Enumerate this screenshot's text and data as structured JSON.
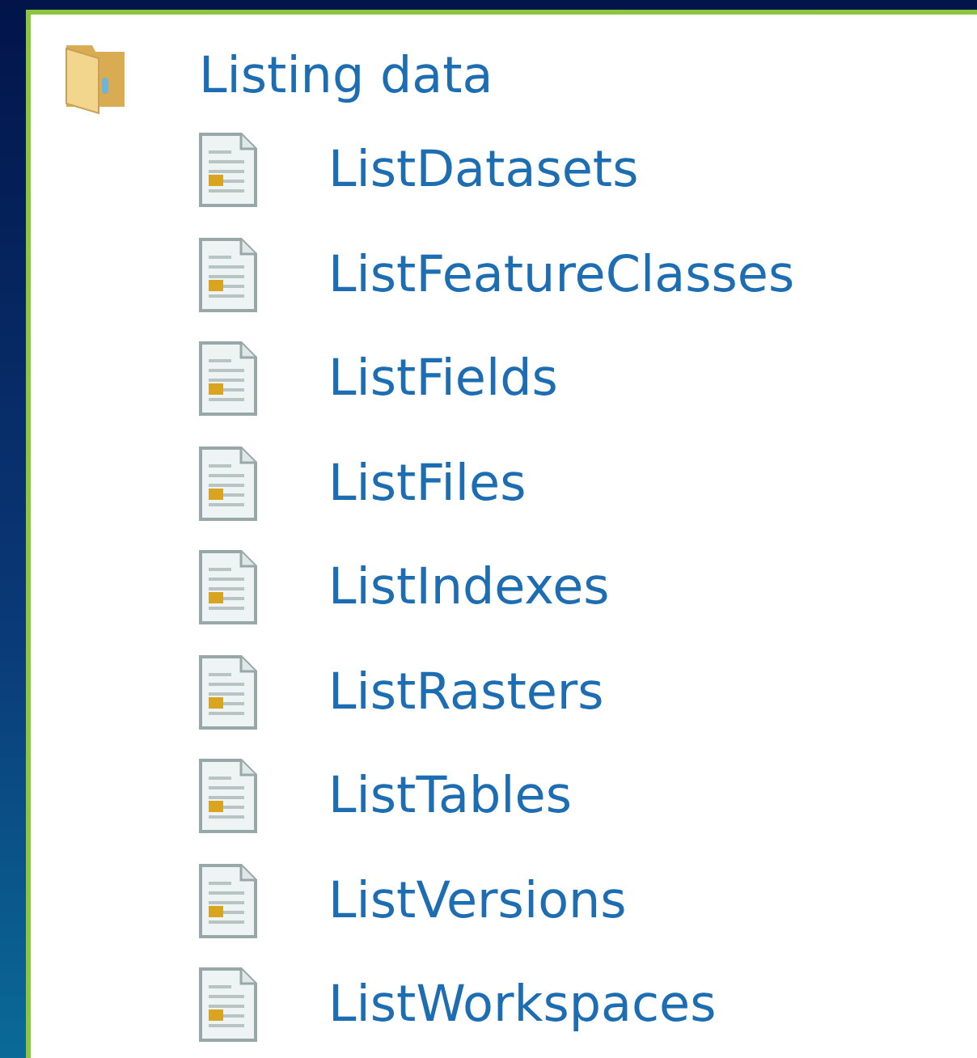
{
  "tree": {
    "label": "Listing data",
    "kind": "folder",
    "children": [
      {
        "label": "ListDatasets",
        "kind": "file"
      },
      {
        "label": "ListFeatureClasses",
        "kind": "file"
      },
      {
        "label": "ListFields",
        "kind": "file"
      },
      {
        "label": "ListFiles",
        "kind": "file"
      },
      {
        "label": "ListIndexes",
        "kind": "file"
      },
      {
        "label": "ListRasters",
        "kind": "file"
      },
      {
        "label": "ListTables",
        "kind": "file"
      },
      {
        "label": "ListVersions",
        "kind": "file"
      },
      {
        "label": "ListWorkspaces",
        "kind": "file"
      }
    ]
  }
}
